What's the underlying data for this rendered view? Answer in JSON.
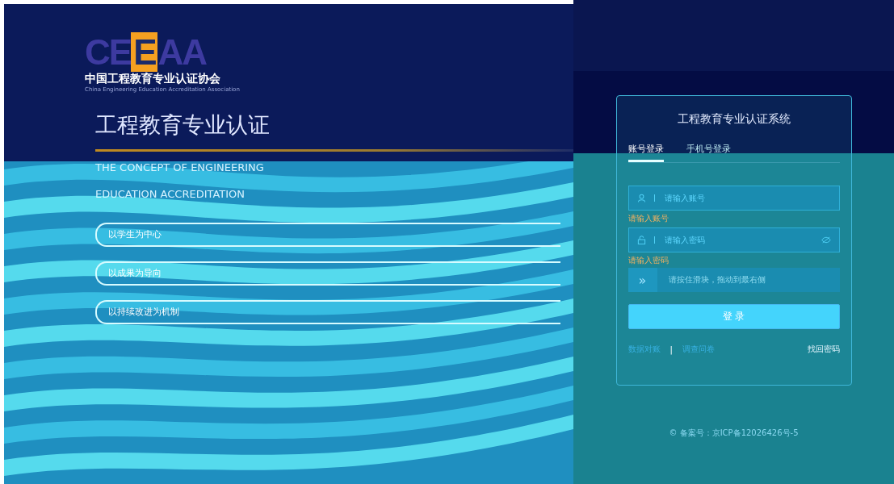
{
  "brand": {
    "logo": "CEEAA",
    "name_cn": "中国工程教育专业认证协会",
    "name_en": "China Engineering Education Accreditation Association"
  },
  "hero": {
    "title": "工程教育专业认证",
    "subtitle_lines": [
      "THE CONCEPT OF ENGINEERING",
      "EDUCATION ACCREDITATION"
    ],
    "principles": [
      "以学生为中心",
      "以成果为导向",
      "以持续改进为机制"
    ]
  },
  "login": {
    "title": "工程教育专业认证系统",
    "tabs": [
      {
        "label": "账号登录",
        "selected": true
      },
      {
        "label": "手机号登录",
        "selected": false
      }
    ],
    "fields": [
      {
        "kind": "account",
        "placeholder": "请输入账号",
        "error": "请输入账号"
      },
      {
        "kind": "password",
        "placeholder": "请输入密码",
        "error": "请输入密码"
      }
    ],
    "slider": {
      "handle": "»",
      "placeholder": "请按住滑块，拖动到最右侧"
    },
    "submit": "登 录",
    "links": [
      "数据对账",
      "调查问卷"
    ],
    "separator": "|",
    "forgot": "找回密码"
  },
  "footer": "© 备案号：京ICP备12026426号-5"
}
